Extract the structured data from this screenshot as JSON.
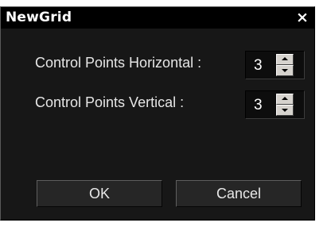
{
  "dialog": {
    "title": "NewGrid",
    "close_symbol": "×",
    "close_icon": "close-icon"
  },
  "fields": [
    {
      "label": "Control Points Horizontal :",
      "value": "3"
    },
    {
      "label": "Control Points Vertical :",
      "value": "3"
    }
  ],
  "buttons": {
    "ok": "OK",
    "cancel": "Cancel"
  },
  "colors": {
    "dialog_bg": "#171717",
    "titlebar_bg": "#000000",
    "button_bg": "#262626",
    "spinner_button": "#d6d3ce"
  }
}
